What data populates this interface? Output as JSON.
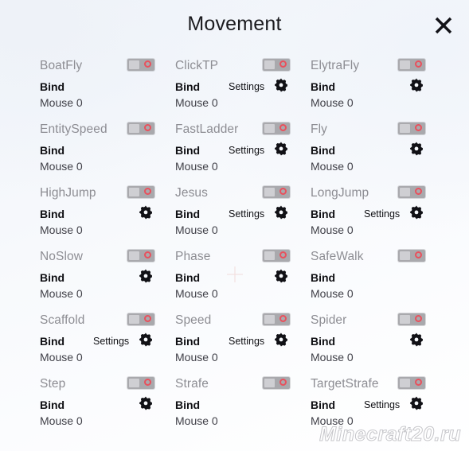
{
  "window": {
    "title": "Movement",
    "close_icon": "close-x-icon"
  },
  "labels": {
    "bind": "Bind",
    "settings": "Settings",
    "gear_icon": "gear-icon",
    "toggle_icon": "toggle-switch-off"
  },
  "watermark": "Minecraft20.ru",
  "colors": {
    "background": "#f5f8fc",
    "module_name": "#8d8d93",
    "bind_label": "#101014",
    "keybind_value": "#404048",
    "toggle_track": "#a9a9ad",
    "toggle_knob": "#cfcfd3",
    "toggle_ring": "#e8515d",
    "gear": "#111116",
    "title": "#1b1b1f"
  },
  "rows": [
    [
      {
        "name": "BoatFly",
        "enabled": false,
        "keybind": "Mouse 0",
        "has_settings": false,
        "settings_label": false
      },
      {
        "name": "ClickTP",
        "enabled": false,
        "keybind": "Mouse 0",
        "has_settings": true,
        "settings_label": true
      },
      {
        "name": "ElytraFly",
        "enabled": false,
        "keybind": "Mouse 0",
        "has_settings": true,
        "settings_label": false
      }
    ],
    [
      {
        "name": "EntitySpeed",
        "enabled": false,
        "keybind": "Mouse 0",
        "has_settings": false,
        "settings_label": false
      },
      {
        "name": "FastLadder",
        "enabled": false,
        "keybind": "Mouse 0",
        "has_settings": true,
        "settings_label": true
      },
      {
        "name": "Fly",
        "enabled": false,
        "keybind": "Mouse 0",
        "has_settings": true,
        "settings_label": false
      }
    ],
    [
      {
        "name": "HighJump",
        "enabled": false,
        "keybind": "Mouse 0",
        "has_settings": true,
        "settings_label": false
      },
      {
        "name": "Jesus",
        "enabled": false,
        "keybind": "Mouse 0",
        "has_settings": true,
        "settings_label": true
      },
      {
        "name": "LongJump",
        "enabled": false,
        "keybind": "Mouse 0",
        "has_settings": true,
        "settings_label": true
      }
    ],
    [
      {
        "name": "NoSlow",
        "enabled": false,
        "keybind": "Mouse 0",
        "has_settings": true,
        "settings_label": false
      },
      {
        "name": "Phase",
        "enabled": false,
        "keybind": "Mouse 0",
        "has_settings": true,
        "settings_label": false
      },
      {
        "name": "SafeWalk",
        "enabled": false,
        "keybind": "Mouse 0",
        "has_settings": false,
        "settings_label": false
      }
    ],
    [
      {
        "name": "Scaffold",
        "enabled": false,
        "keybind": "Mouse 0",
        "has_settings": true,
        "settings_label": true
      },
      {
        "name": "Speed",
        "enabled": false,
        "keybind": "Mouse 0",
        "has_settings": true,
        "settings_label": true
      },
      {
        "name": "Spider",
        "enabled": false,
        "keybind": "Mouse 0",
        "has_settings": true,
        "settings_label": false
      }
    ],
    [
      {
        "name": "Step",
        "enabled": false,
        "keybind": "Mouse 0",
        "has_settings": true,
        "settings_label": false
      },
      {
        "name": "Strafe",
        "enabled": false,
        "keybind": "Mouse 0",
        "has_settings": false,
        "settings_label": false
      },
      {
        "name": "TargetStrafe",
        "enabled": false,
        "keybind": "Mouse 0",
        "has_settings": true,
        "settings_label": true
      }
    ]
  ]
}
